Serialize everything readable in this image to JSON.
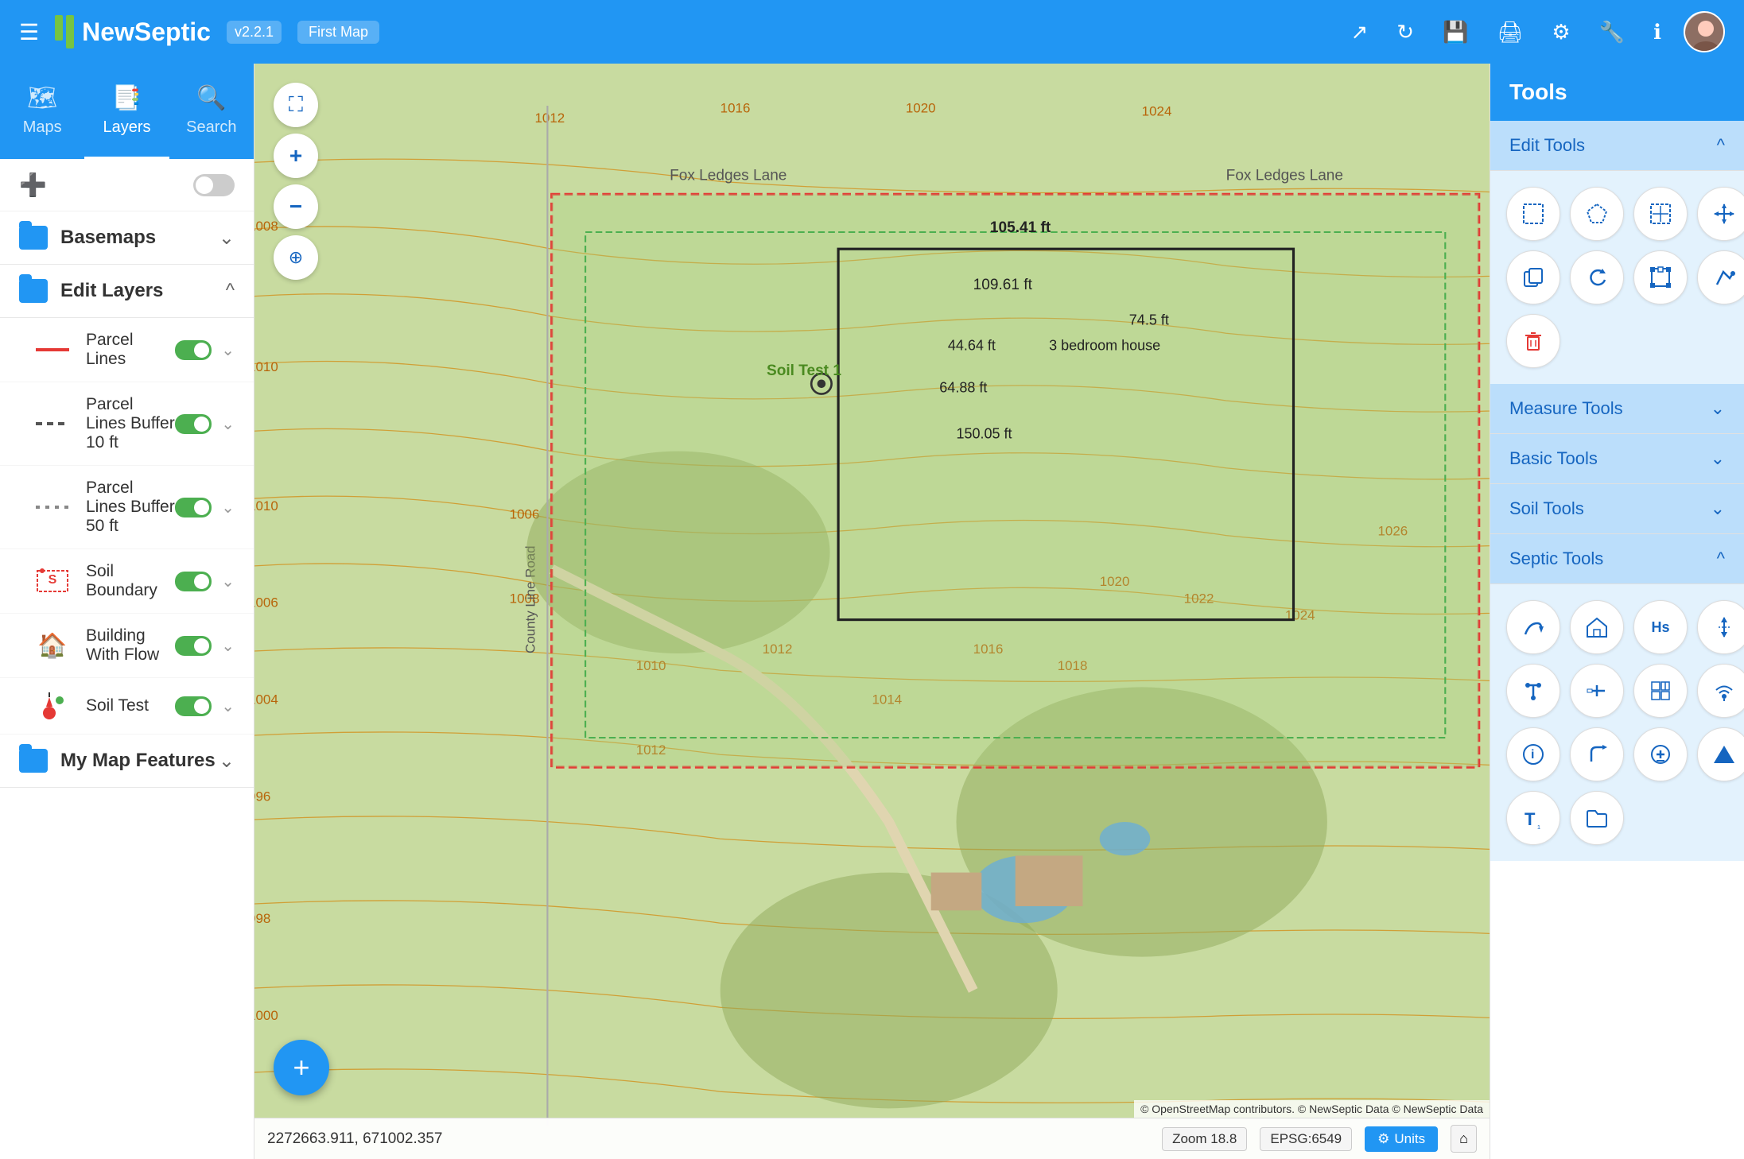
{
  "app": {
    "title": "NewSeptic",
    "version": "v2.2.1",
    "map_name": "First Map"
  },
  "nav": {
    "tabs": [
      {
        "id": "maps",
        "label": "Maps",
        "icon": "🗺"
      },
      {
        "id": "layers",
        "label": "Layers",
        "icon": "📑",
        "active": true
      },
      {
        "id": "search",
        "label": "Search",
        "icon": "🔍"
      }
    ]
  },
  "sidebar": {
    "basemaps_label": "Basemaps",
    "edit_layers_label": "Edit Layers",
    "my_map_features_label": "My Map Features",
    "layers": [
      {
        "id": "parcel-lines",
        "name": "Parcel Lines",
        "type": "solid-red",
        "enabled": true
      },
      {
        "id": "parcel-buffer-10",
        "name": "Parcel Lines Buffer 10 ft",
        "type": "dashed-dark",
        "enabled": true
      },
      {
        "id": "parcel-buffer-50",
        "name": "Parcel Lines Buffer 50 ft",
        "type": "dashed-light",
        "enabled": true
      },
      {
        "id": "soil-boundary",
        "name": "Soil Boundary",
        "type": "soil",
        "enabled": true
      },
      {
        "id": "building-with-flow",
        "name": "Building With Flow",
        "type": "building",
        "enabled": true
      },
      {
        "id": "soil-test",
        "name": "Soil Test",
        "type": "soil-test",
        "enabled": true
      }
    ]
  },
  "map": {
    "coordinates": "2272663.911, 671002.357",
    "zoom_label": "Zoom 18.8",
    "epsg_label": "EPSG:6549",
    "units_label": "Units",
    "attribution": "© OpenStreetMap contributors. © NewSeptic Data © NewSeptic Data",
    "labels": {
      "fox_ledges_lane": "Fox Ledges Lane",
      "fox_ledges_lane2": "Fox Ledges Lane",
      "soil_test_1": "Soil Test 1",
      "bedroom_house": "3 bedroom house",
      "dim_105": "105.41 ft",
      "dim_109": "109.61 ft",
      "dim_74": "74.5 ft",
      "dim_44": "44.64 ft",
      "dim_64": "64.88 ft",
      "dim_150": "150.05 ft"
    }
  },
  "tools": {
    "panel_title": "Tools",
    "sections": [
      {
        "id": "edit-tools",
        "label": "Edit Tools",
        "expanded": true,
        "tools": [
          {
            "id": "select-box",
            "icon": "⬜",
            "label": "Select Box"
          },
          {
            "id": "select-poly",
            "icon": "⬡",
            "label": "Select Polygon"
          },
          {
            "id": "select-point",
            "icon": "✛",
            "label": "Select Point"
          },
          {
            "id": "move",
            "icon": "✛",
            "label": "Move"
          },
          {
            "id": "copy",
            "icon": "⧉",
            "label": "Copy"
          },
          {
            "id": "rotate",
            "icon": "↻",
            "label": "Rotate"
          },
          {
            "id": "edit-shape",
            "icon": "✏",
            "label": "Edit Shape"
          },
          {
            "id": "snap",
            "icon": "◎",
            "label": "Snap"
          },
          {
            "id": "delete",
            "icon": "🗑",
            "label": "Delete"
          }
        ]
      },
      {
        "id": "measure-tools",
        "label": "Measure Tools",
        "expanded": false,
        "tools": []
      },
      {
        "id": "basic-tools",
        "label": "Basic Tools",
        "expanded": false,
        "tools": []
      },
      {
        "id": "soil-tools",
        "label": "Soil Tools",
        "expanded": false,
        "tools": []
      },
      {
        "id": "septic-tools",
        "label": "Septic Tools",
        "expanded": true,
        "tools": [
          {
            "id": "septic-1",
            "icon": "↩",
            "label": "Drain Field"
          },
          {
            "id": "septic-2",
            "icon": "🏠",
            "label": "House"
          },
          {
            "id": "septic-3",
            "icon": "Hs",
            "label": "H symbol"
          },
          {
            "id": "septic-4",
            "icon": "⇅",
            "label": "Up Down"
          },
          {
            "id": "septic-5",
            "icon": "T",
            "label": "T shape"
          },
          {
            "id": "septic-6",
            "icon": "⊣",
            "label": "Dash line"
          },
          {
            "id": "septic-7",
            "icon": "⊞",
            "label": "Grid"
          },
          {
            "id": "septic-8",
            "icon": "📡",
            "label": "Signal"
          },
          {
            "id": "septic-9",
            "icon": "ℹ",
            "label": "Info"
          },
          {
            "id": "septic-10",
            "icon": "↰",
            "label": "Turn"
          },
          {
            "id": "septic-11",
            "icon": "⊕",
            "label": "Plus circle"
          },
          {
            "id": "septic-12",
            "icon": "▲",
            "label": "Triangle"
          },
          {
            "id": "septic-13",
            "icon": "T₁",
            "label": "Text T"
          },
          {
            "id": "septic-14",
            "icon": "📁",
            "label": "Folder"
          }
        ]
      }
    ]
  }
}
